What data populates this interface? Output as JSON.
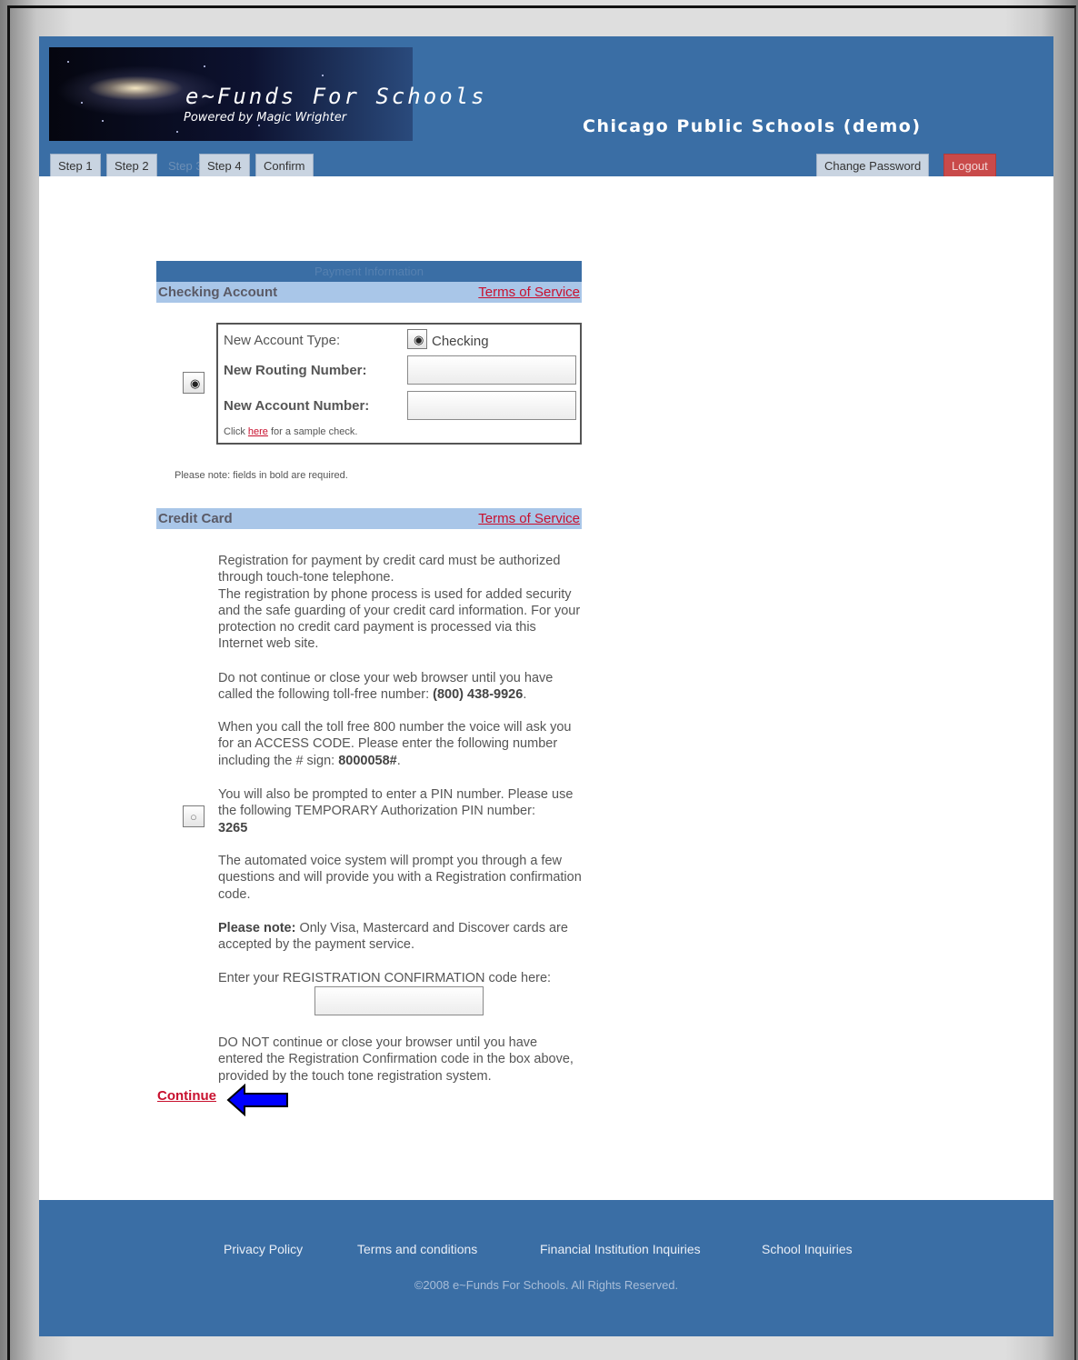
{
  "header": {
    "brand_title": "e~Funds For Schools",
    "brand_subtitle": "Powered by Magic Wrighter",
    "org_title": "Chicago Public Schools (demo)"
  },
  "tabs": [
    {
      "label": "Step 1"
    },
    {
      "label": "Step 2"
    },
    {
      "label": "Step 3"
    },
    {
      "label": "Step 4"
    },
    {
      "label": "Confirm"
    }
  ],
  "account_tabs": {
    "change_password": "Change Password",
    "logout": "Logout"
  },
  "payment": {
    "section_title": "Payment Information",
    "checking": {
      "title": "Checking Account",
      "tos_link": "Terms of Service",
      "account_type_label": "New Account Type:",
      "account_type_value": "Checking",
      "routing_label": "New Routing Number:",
      "routing_value": "",
      "account_number_label": "New Account Number:",
      "account_number_value": "",
      "sample_prefix": "Click",
      "sample_link": "here",
      "sample_suffix": "for a sample check.",
      "selected": true
    },
    "required_note": "Please note: fields in bold are required.",
    "credit_card": {
      "title": "Credit Card",
      "tos_link": "Terms of Service",
      "selected": false,
      "p1": "Registration for payment by credit card must be authorized through touch-tone telephone.",
      "p1b": "The registration by phone process is used for added security and the safe guarding of your credit card information. For your protection no credit card payment is processed via this Internet web site.",
      "p2_text": "Do not continue or close your web browser until you have called the following toll-free number:",
      "p2_phone": "(800) 438-9926",
      "p3_text": "When you call the toll free 800 number the voice will ask you for an ACCESS CODE. Please enter the following number including the # sign:",
      "p3_code": "8000058#",
      "p4_text": "You will also be prompted to enter a PIN number. Please use the following TEMPORARY Authorization PIN number:",
      "p4_pin": "3265",
      "p5": "The automated voice system will prompt you through a few questions and will provide you with a Registration confirmation code.",
      "p6_bold": "Please note:",
      "p6_text": "Only Visa, Mastercard and Discover cards are accepted by the payment service.",
      "p7": "Enter your REGISTRATION CONFIRMATION code here:",
      "confirmation_value": "",
      "p8": "DO NOT continue or close your browser until you have entered the Registration Confirmation code in the box above, provided by the touch tone registration system."
    },
    "continue_label": "Continue"
  },
  "footer": {
    "links": [
      "Privacy Policy",
      "Terms and conditions",
      "Financial Institution Inquiries",
      "School Inquiries"
    ],
    "copyright": "©2008 e~Funds For Schools. All Rights Reserved."
  },
  "colors": {
    "header_blue": "#3a6ea5",
    "section_bar": "#a9c6e8",
    "link_red": "#c8102e",
    "logout_red": "#c94a4a",
    "arrow_blue": "#0000ff"
  }
}
